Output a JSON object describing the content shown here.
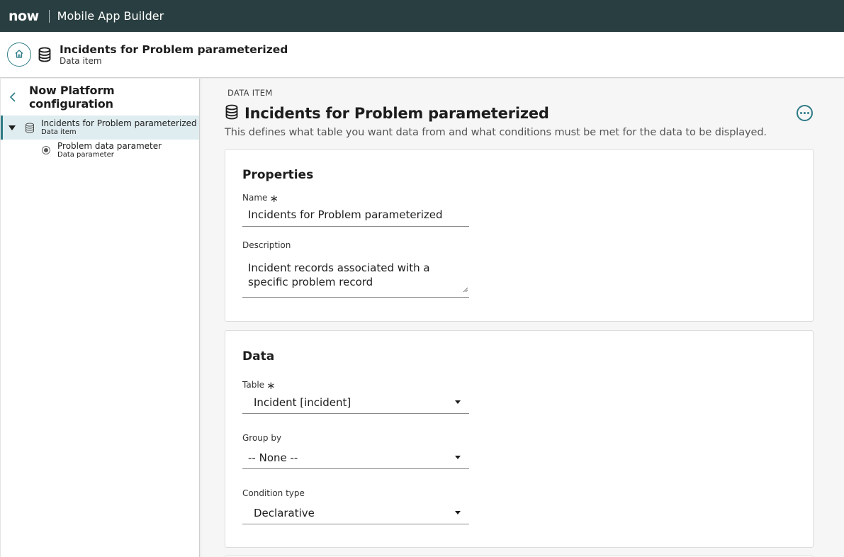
{
  "topbar": {
    "logo_text": "now",
    "app_title": "Mobile App Builder"
  },
  "header": {
    "title": "Incidents for Problem parameterized",
    "subtitle": "Data item",
    "icons": [
      "home-icon",
      "database-icon"
    ]
  },
  "sidebar": {
    "title": "Now Platform configuration",
    "items": [
      {
        "label": "Incidents for Problem parameterized",
        "type": "Data item",
        "selected": true,
        "icon": "database-icon"
      },
      {
        "label": "Problem data parameter",
        "type": "Data parameter",
        "selected": false,
        "icon": "radio-icon"
      }
    ]
  },
  "main": {
    "kicker": "DATA ITEM",
    "title": "Incidents for Problem parameterized",
    "description": "This defines what table you want data from and what conditions must be met for the data to be displayed.",
    "properties": {
      "heading": "Properties",
      "name_label": "Name",
      "name_value": "Incidents for Problem parameterized",
      "description_label": "Description",
      "description_value": "Incident records associated with a specific problem record"
    },
    "data": {
      "heading": "Data",
      "table_label": "Table",
      "table_value": "Incident [incident]",
      "group_label": "Group by",
      "group_value": "-- None --",
      "condition_label": "Condition type",
      "condition_value": "Declarative"
    },
    "required_marker": "∗"
  },
  "colors": {
    "topbar": "#293e40",
    "accent": "#2e7b86",
    "selected_bg": "#e0edf0"
  }
}
